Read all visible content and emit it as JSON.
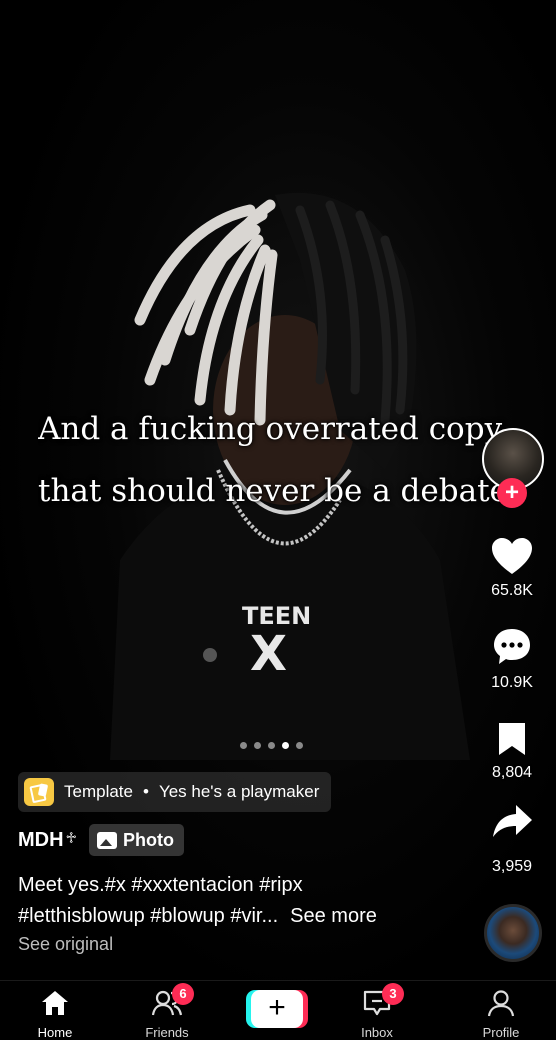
{
  "overlay_caption": {
    "line1": "And a fucking overrated copy",
    "line2": "that should never be a debate"
  },
  "actions": {
    "likes": "65.8K",
    "comments": "10.9K",
    "saves": "8,804",
    "shares": "3,959",
    "follow_symbol": "+"
  },
  "pager": {
    "count": 5,
    "active_index": 3
  },
  "template": {
    "label": "Template",
    "separator": "•",
    "name": "Yes he's a playmaker"
  },
  "author": {
    "name": "MDH",
    "name_symbol": "♱",
    "badge_label": "Photo"
  },
  "description": {
    "line1": "Meet yes.#x #xxxtentacion #ripx",
    "line2": "#letthisblowup #blowup #vir...",
    "see_more": "See more"
  },
  "see_original": "See original",
  "nav": {
    "home": "Home",
    "friends": "Friends",
    "friends_badge": "6",
    "create": "+",
    "inbox": "Inbox",
    "inbox_badge": "3",
    "profile": "Profile"
  },
  "pendant_text": {
    "line1": "TEEN",
    "line2": "X"
  },
  "colors": {
    "accent": "#fe2c55",
    "teal": "#25f4ee",
    "template_yellow": "#f7c843"
  }
}
